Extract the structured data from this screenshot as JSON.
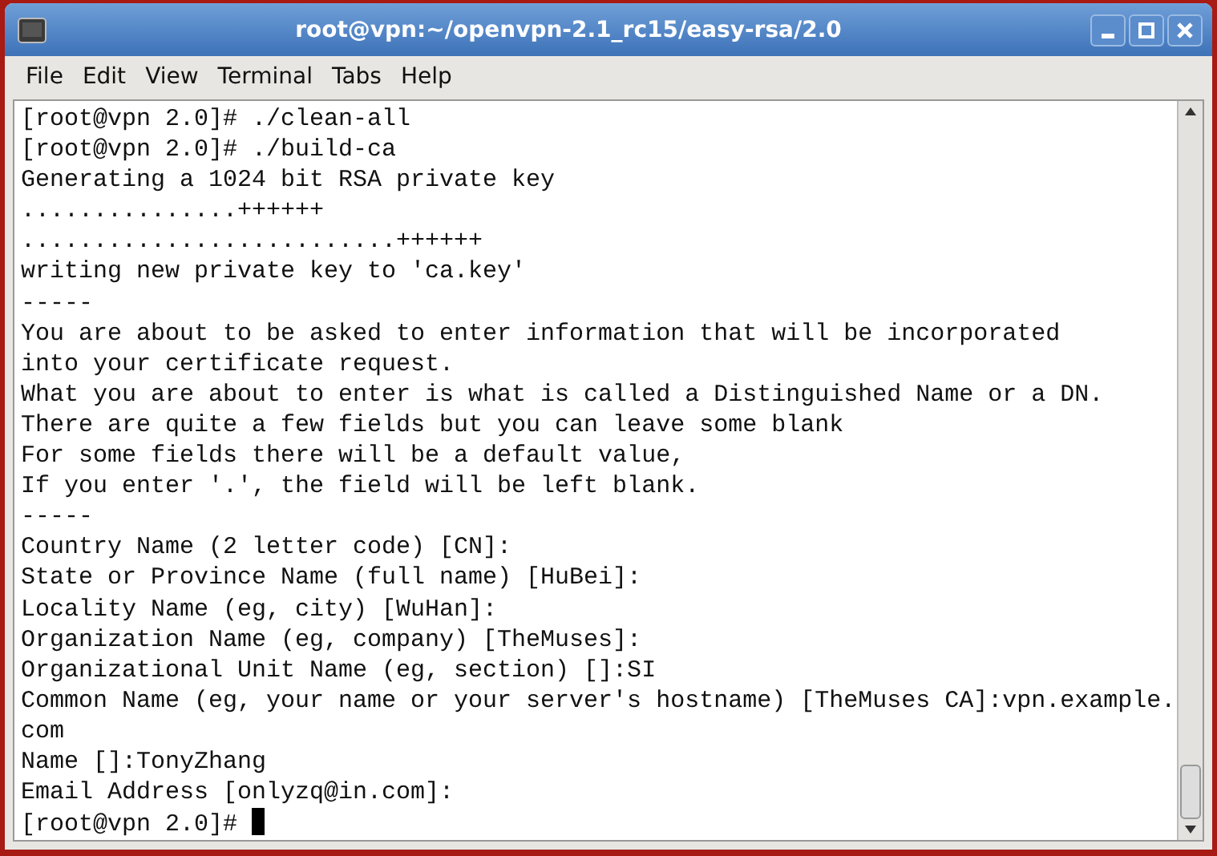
{
  "window": {
    "title": "root@vpn:~/openvpn-2.1_rc15/easy-rsa/2.0"
  },
  "menu": [
    {
      "label": "File"
    },
    {
      "label": "Edit"
    },
    {
      "label": "View"
    },
    {
      "label": "Terminal"
    },
    {
      "label": "Tabs"
    },
    {
      "label": "Help"
    }
  ],
  "terminal": {
    "lines": [
      "[root@vpn 2.0]# ./clean-all",
      "[root@vpn 2.0]# ./build-ca",
      "Generating a 1024 bit RSA private key",
      "...............++++++",
      "..........................++++++",
      "writing new private key to 'ca.key'",
      "-----",
      "You are about to be asked to enter information that will be incorporated",
      "into your certificate request.",
      "What you are about to enter is what is called a Distinguished Name or a DN.",
      "There are quite a few fields but you can leave some blank",
      "For some fields there will be a default value,",
      "If you enter '.', the field will be left blank.",
      "-----",
      "Country Name (2 letter code) [CN]:",
      "State or Province Name (full name) [HuBei]:",
      "Locality Name (eg, city) [WuHan]:",
      "Organization Name (eg, company) [TheMuses]:",
      "Organizational Unit Name (eg, section) []:SI",
      "Common Name (eg, your name or your server's hostname) [TheMuses CA]:vpn.example.",
      "com",
      "Name []:TonyZhang",
      "Email Address [onlyzq@in.com]:",
      "[root@vpn 2.0]# "
    ],
    "cursor": true
  }
}
